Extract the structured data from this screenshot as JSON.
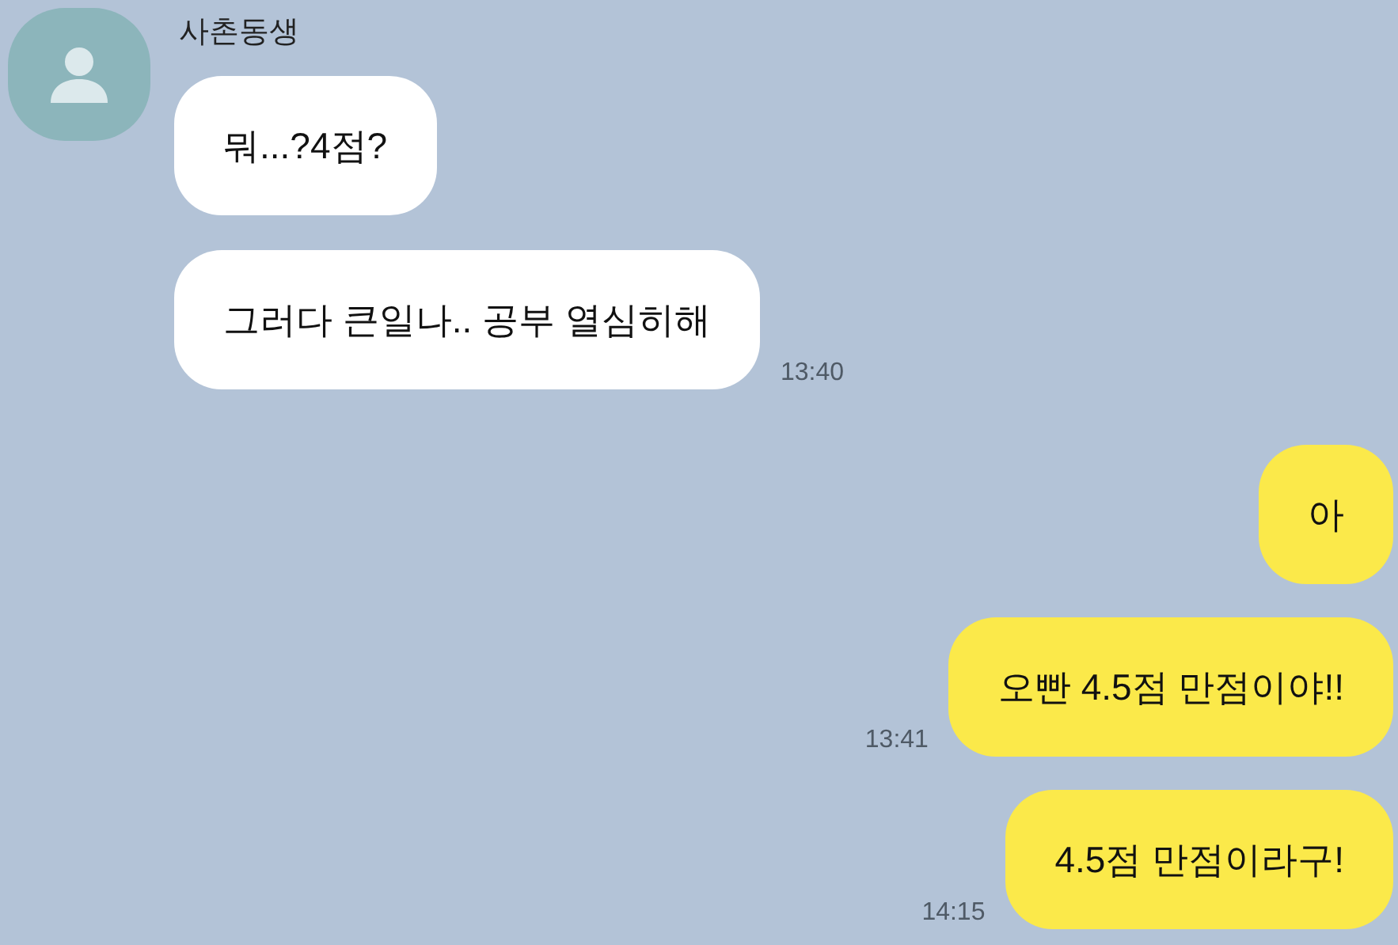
{
  "contact": {
    "name": "사촌동생"
  },
  "messages": [
    {
      "kind": "received",
      "text": "뭐...?4점?"
    },
    {
      "kind": "received",
      "text": "그러다 큰일나.. 공부 열심히해",
      "time": "13:40"
    },
    {
      "kind": "sent",
      "text": "아"
    },
    {
      "kind": "sent",
      "text": "오빤 4.5점 만점이야!!",
      "time": "13:41"
    },
    {
      "kind": "sent",
      "text": "4.5점 만점이라구!",
      "time": "14:15"
    }
  ]
}
